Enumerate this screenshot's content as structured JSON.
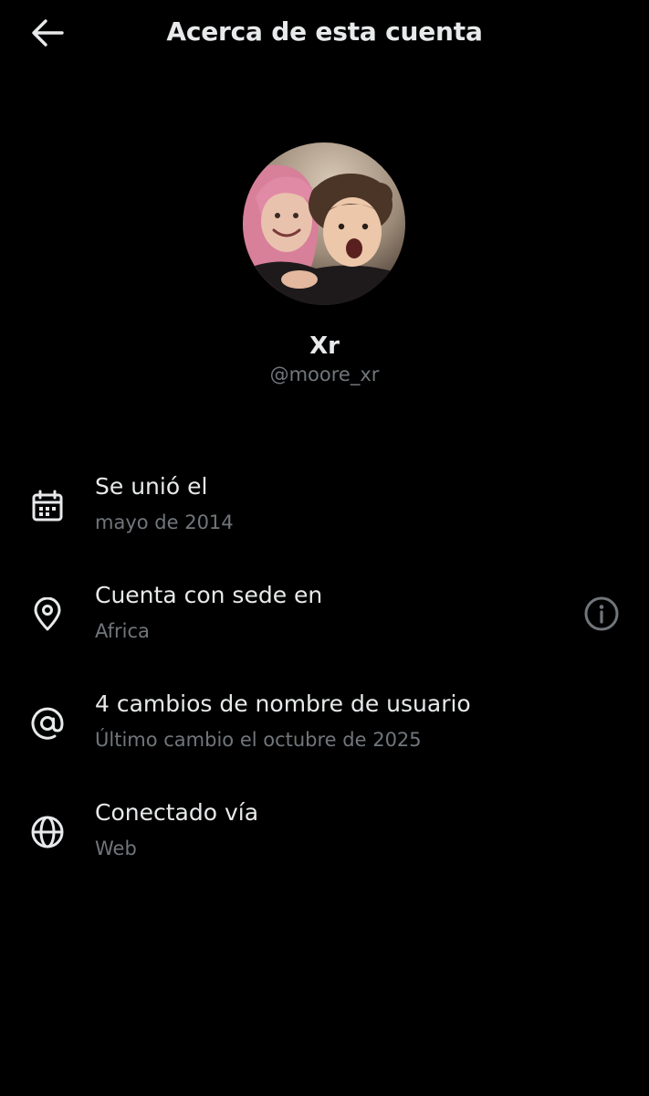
{
  "header": {
    "back_icon": "arrow-left-icon",
    "title": "Acerca de esta cuenta"
  },
  "profile": {
    "avatar_description": "profile-photo",
    "display_name": "Xr",
    "handle": "@moore_xr"
  },
  "details": [
    {
      "icon": "calendar-icon",
      "label": "Se unió el",
      "value": "mayo de 2014"
    },
    {
      "icon": "location-pin-icon",
      "label": "Cuenta con sede en",
      "value": "Africa",
      "trailing_icon": "info-icon"
    },
    {
      "icon": "at-sign-icon",
      "label": "4 cambios de nombre de usuario",
      "value": "Último cambio el octubre de 2025"
    },
    {
      "icon": "globe-icon",
      "label": "Conectado vía",
      "value": "Web"
    }
  ],
  "colors": {
    "background": "#000000",
    "primary_text": "#e7e9ea",
    "secondary_text": "#71767b"
  }
}
